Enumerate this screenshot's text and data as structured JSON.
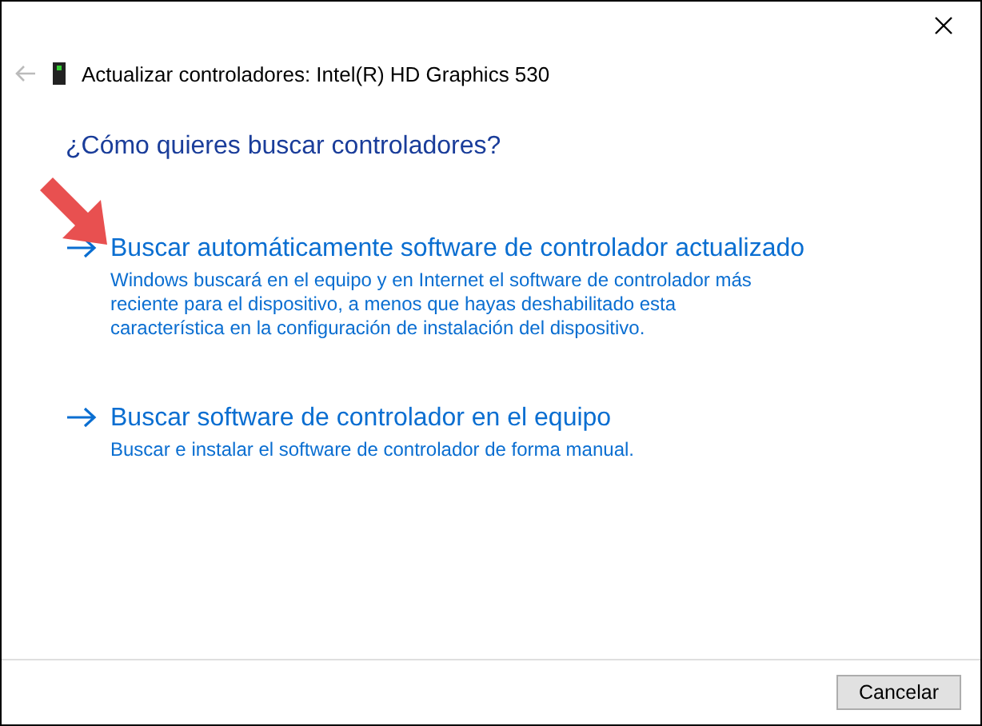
{
  "window": {
    "title": "Actualizar controladores: Intel(R) HD Graphics 530"
  },
  "heading": "¿Cómo quieres buscar controladores?",
  "options": [
    {
      "title": "Buscar automáticamente software de controlador actualizado",
      "description": "Windows buscará en el equipo y en Internet el software de controlador más reciente para el dispositivo, a menos que hayas deshabilitado esta característica en la configuración de instalación del dispositivo."
    },
    {
      "title": "Buscar software de controlador en el equipo",
      "description": "Buscar e instalar el software de controlador de forma manual."
    }
  ],
  "buttons": [
    "Cancelar"
  ]
}
